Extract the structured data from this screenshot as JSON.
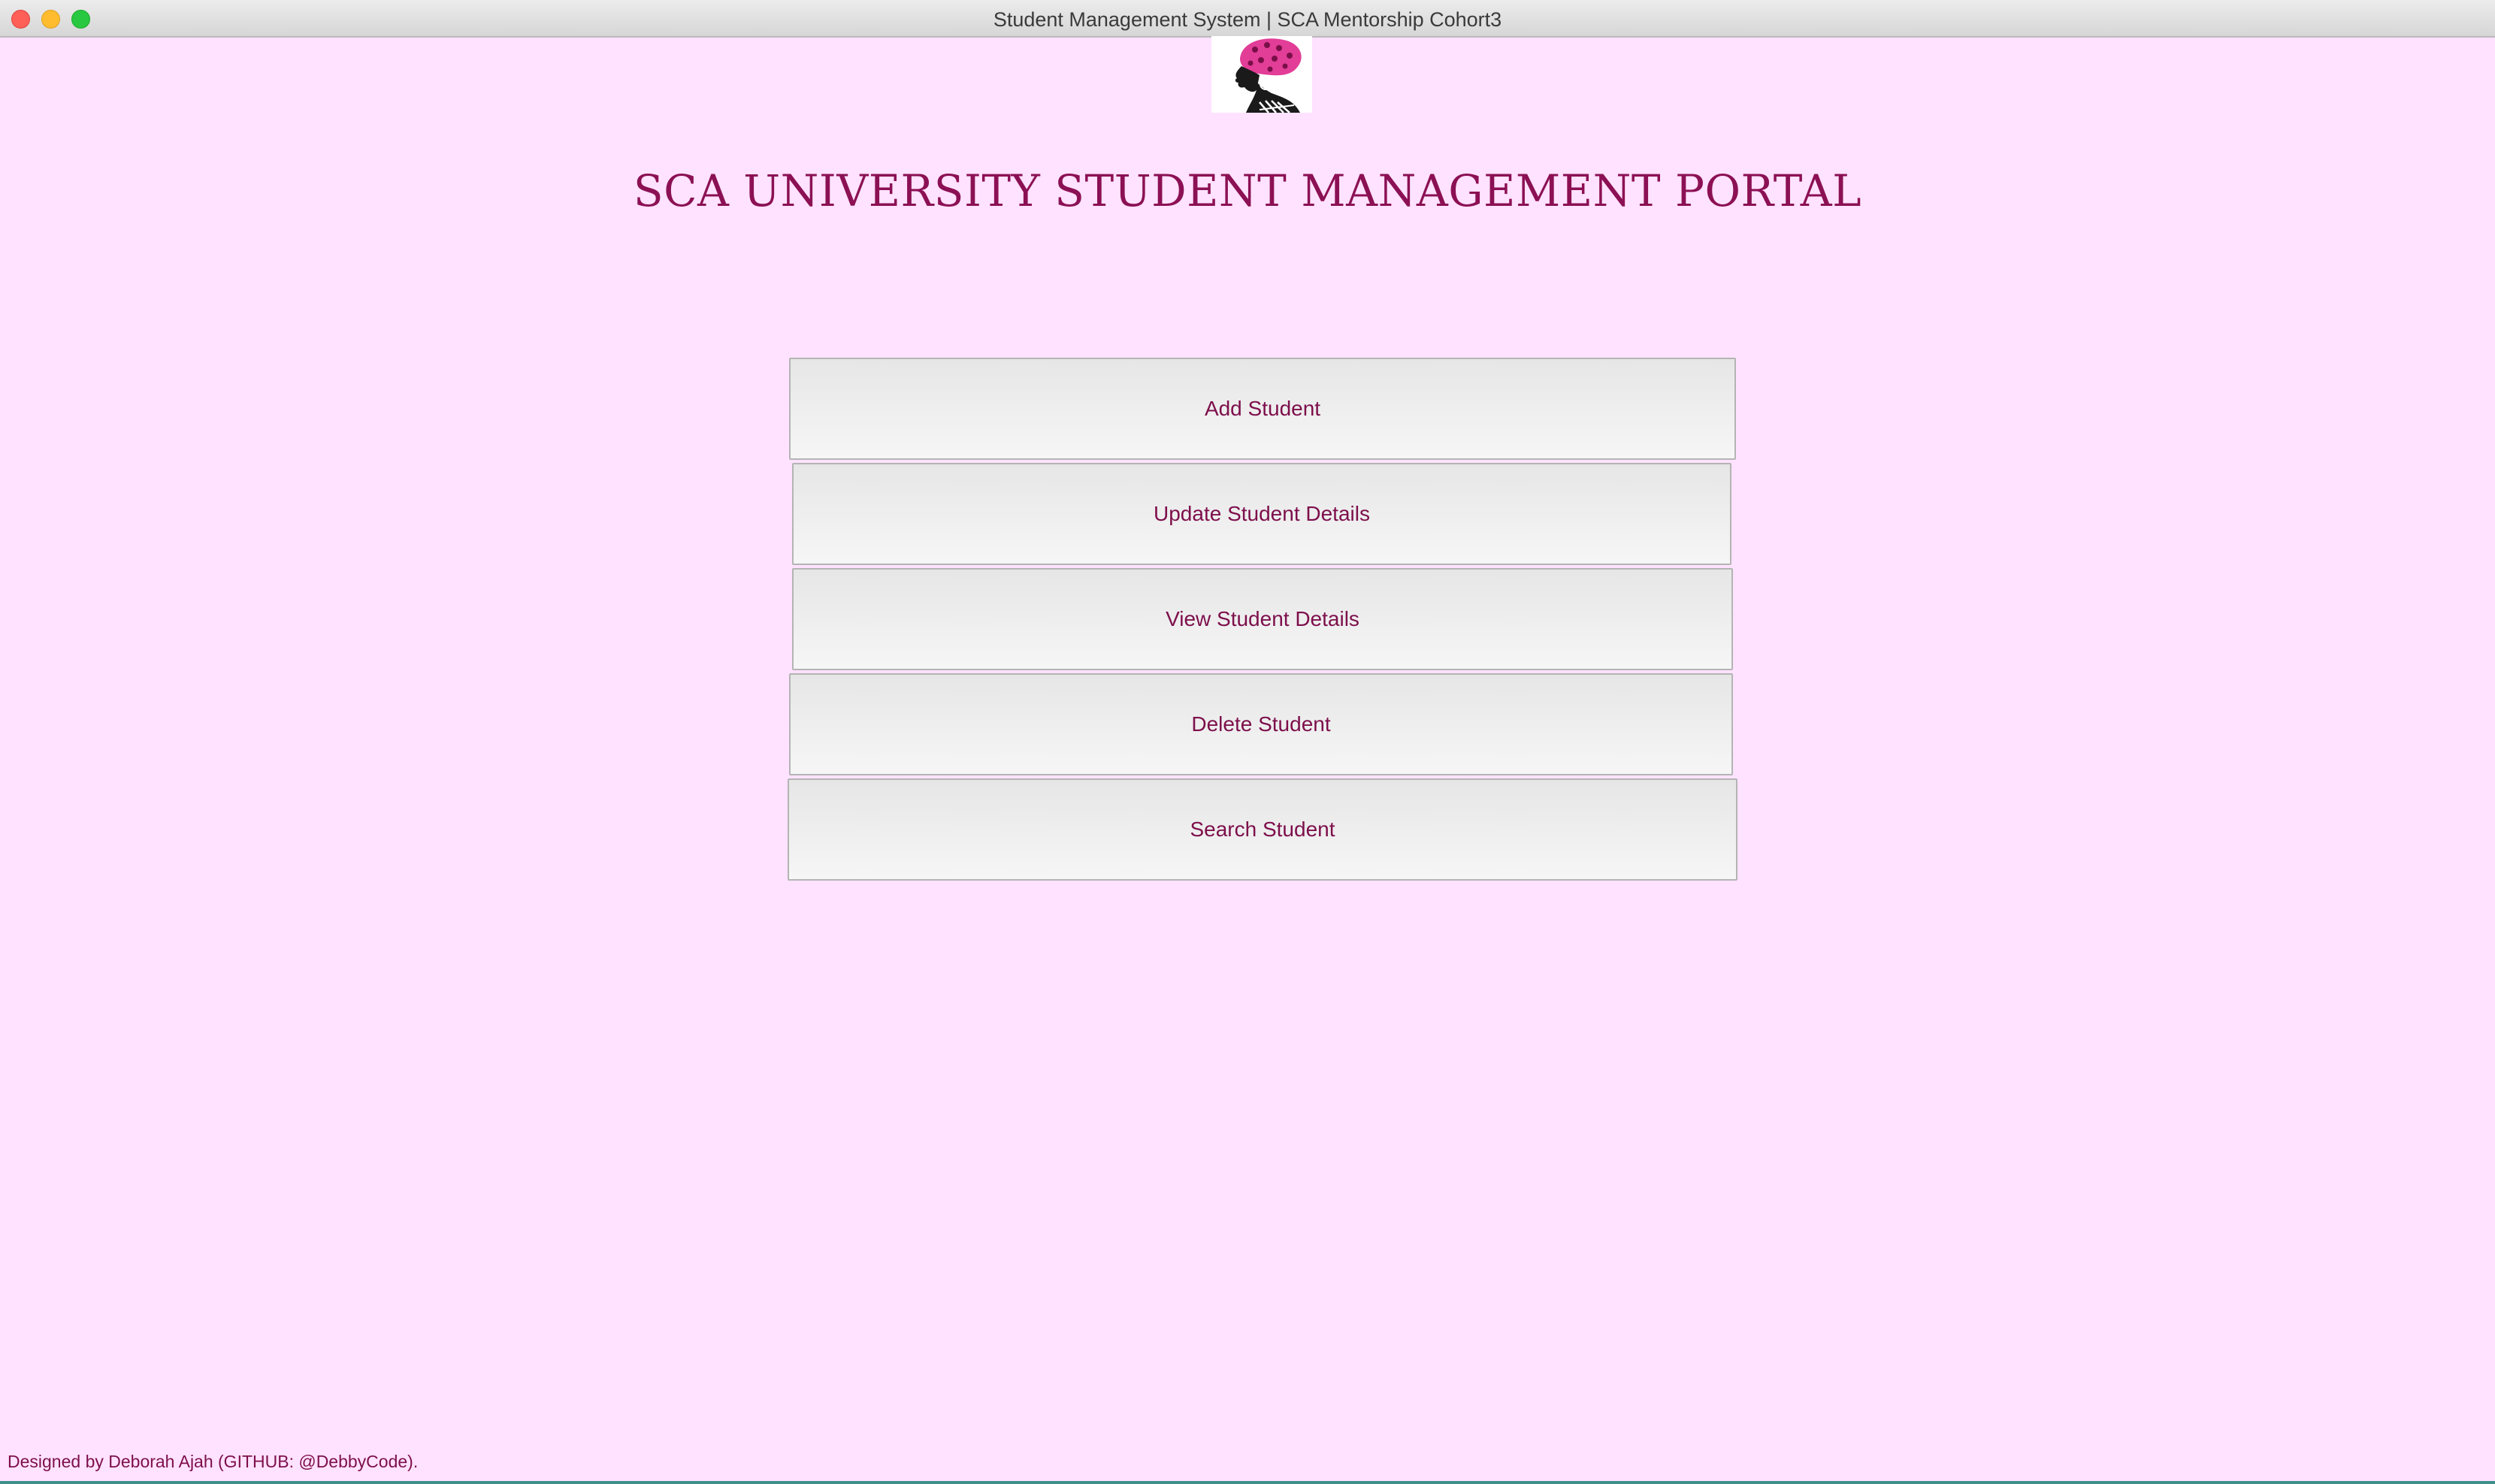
{
  "window": {
    "title": "Student Management System | SCA Mentorship Cohort3"
  },
  "logo": {
    "icon": "woman-with-headwrap-logo"
  },
  "header": {
    "title": "SCA UNIVERSITY STUDENT MANAGEMENT PORTAL"
  },
  "menu": {
    "buttons": [
      {
        "label": "Add Student"
      },
      {
        "label": "Update Student Details"
      },
      {
        "label": "View Student Details"
      },
      {
        "label": "Delete Student"
      },
      {
        "label": "Search Student"
      }
    ]
  },
  "footer": {
    "credit": "Designed by Deborah Ajah (GITHUB: @DebbyCode)."
  },
  "colors": {
    "background": "#ffe2ff",
    "accent": "#8b1054",
    "button_text": "#7d0f4b",
    "button_fill": "#eeeeee"
  }
}
